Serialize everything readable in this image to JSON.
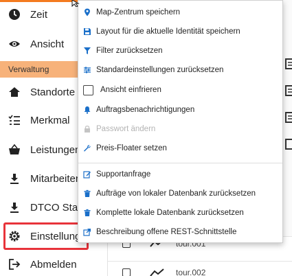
{
  "sidebar": {
    "items": [
      {
        "label": "Zeit",
        "icon": "clock-icon"
      },
      {
        "label": "Ansicht",
        "icon": "eye-icon"
      },
      {
        "label": "Standorte",
        "icon": "home-icon"
      },
      {
        "label": "Merkmal",
        "icon": "list-icon"
      },
      {
        "label": "Leistungen",
        "icon": "basket-icon"
      },
      {
        "label": "Mitarbeiter",
        "icon": "download-icon"
      },
      {
        "label": "DTCO Stat",
        "icon": "download-icon"
      },
      {
        "label": "Einstellung",
        "icon": "gear-icon"
      },
      {
        "label": "Abmelden",
        "icon": "logout-icon"
      }
    ],
    "section_header": "Verwaltung"
  },
  "table": {
    "rows": [
      {
        "tour": "tour.001"
      },
      {
        "tour": "tour.002"
      }
    ]
  },
  "menu": {
    "items": [
      {
        "label": "Map-Zentrum speichern",
        "icon": "map-pin-icon"
      },
      {
        "label": "Layout für die aktuelle Identität speichern",
        "icon": "save-icon"
      },
      {
        "label": "Filter zurücksetzen",
        "icon": "filter-icon"
      },
      {
        "label": "Standardeinstellungen zurücksetzen",
        "icon": "sliders-icon"
      },
      {
        "label": "Ansicht einfrieren",
        "icon": "checkbox"
      },
      {
        "label": "Auftragsbenachrichtigungen",
        "icon": "bell-icon"
      },
      {
        "label": "Passwort ändern",
        "icon": "lock-icon",
        "disabled": true
      },
      {
        "label": "Preis-Floater setzen",
        "icon": "wrench-icon"
      },
      {
        "label": "Supportanfrage",
        "icon": "edit-icon"
      },
      {
        "label": "Aufträge von lokaler Datenbank zurücksetzen",
        "icon": "trash-icon"
      },
      {
        "label": "Komplette lokale Datenbank zurücksetzen",
        "icon": "trash-icon"
      },
      {
        "label": "Beschreibung offene REST-Schnittstelle",
        "icon": "external-link-icon"
      }
    ]
  },
  "colors": {
    "accent": "#1a6fc9",
    "section_header": "#f7b27a",
    "highlight": "#e8333a"
  }
}
